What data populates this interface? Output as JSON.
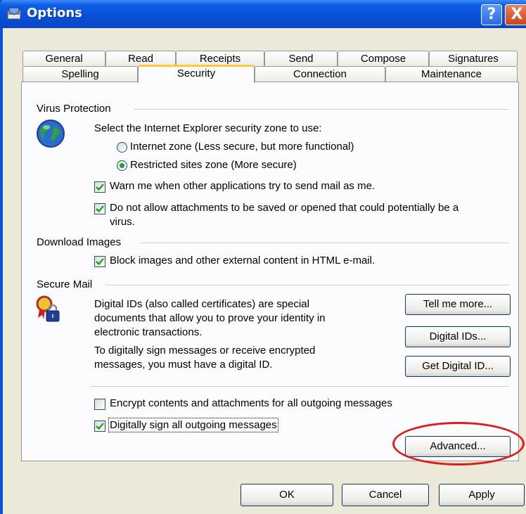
{
  "window": {
    "title": "Options",
    "help_label": "?",
    "close_label": "X"
  },
  "tabs_row1": [
    "General",
    "Read",
    "Receipts",
    "Send",
    "Compose",
    "Signatures"
  ],
  "tabs_row2": [
    "Spelling",
    "Security",
    "Connection",
    "Maintenance"
  ],
  "active_tab": "Security",
  "virus": {
    "heading": "Virus Protection",
    "zone_prompt": "Select the Internet Explorer security zone to use:",
    "radio_internet": "Internet zone (Less secure, but more functional)",
    "radio_restricted": "Restricted sites zone (More secure)",
    "selected_zone": "restricted",
    "warn_label": "Warn me when other applications try to send mail as me.",
    "warn_checked": true,
    "attach_label_1": "Do not allow attachments to be saved or opened that could potentially be a",
    "attach_label_2": "virus.",
    "attach_checked": true
  },
  "download": {
    "heading": "Download Images",
    "block_label": "Block images and other external content in HTML e-mail.",
    "block_checked": true
  },
  "secure": {
    "heading": "Secure Mail",
    "desc1": "Digital IDs (also called certificates) are special",
    "desc2": "documents that allow you to prove your identity in",
    "desc3": "electronic transactions.",
    "desc4": "To digitally sign messages or receive encrypted",
    "desc5": "messages, you must have a digital ID.",
    "tell_more": "Tell me more...",
    "digital_ids": "Digital IDs...",
    "get_digital_id": "Get Digital ID...",
    "encrypt_label": "Encrypt contents and attachments for all outgoing messages",
    "encrypt_checked": false,
    "sign_label": "Digitally sign all outgoing messages",
    "sign_checked": true,
    "advanced": "Advanced..."
  },
  "footer": {
    "ok": "OK",
    "cancel": "Cancel",
    "apply": "Apply"
  },
  "colors": {
    "titlebar": "#0a4fd6",
    "dialog_bg": "#ece9d8",
    "highlight_ellipse": "#e01b1b",
    "active_tab_accent": "#ffc83c"
  }
}
